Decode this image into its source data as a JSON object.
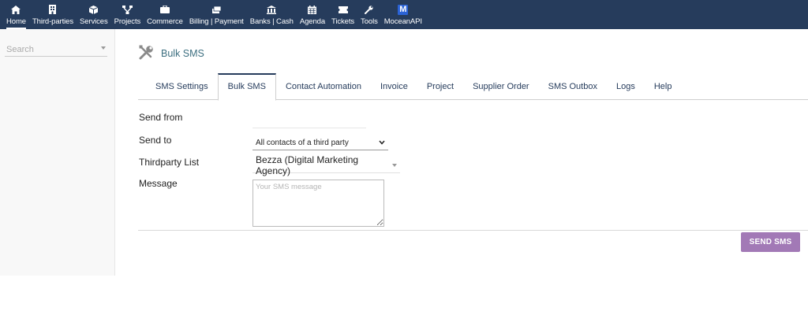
{
  "nav": {
    "items": [
      {
        "label": "Home",
        "icon": "home-icon",
        "active": true
      },
      {
        "label": "Third-parties",
        "icon": "building-icon",
        "active": false
      },
      {
        "label": "Services",
        "icon": "cube-icon",
        "active": false
      },
      {
        "label": "Projects",
        "icon": "sitemap-icon",
        "active": false
      },
      {
        "label": "Commerce",
        "icon": "suitcase-icon",
        "active": false
      },
      {
        "label": "Billing | Payment",
        "icon": "money-bill-icon",
        "active": false
      },
      {
        "label": "Banks | Cash",
        "icon": "bank-icon",
        "active": false
      },
      {
        "label": "Agenda",
        "icon": "calendar-icon",
        "active": false
      },
      {
        "label": "Tickets",
        "icon": "ticket-icon",
        "active": false
      },
      {
        "label": "Tools",
        "icon": "wrench-icon",
        "active": false
      },
      {
        "label": "MoceanAPI",
        "icon": "moceanapi-logo-icon",
        "active": false,
        "logo_letter": "M"
      }
    ]
  },
  "sidebar": {
    "search_placeholder": "Search"
  },
  "page": {
    "title": "Bulk SMS",
    "title_icon": "tools-icon"
  },
  "tabs": [
    {
      "label": "SMS Settings",
      "active": false
    },
    {
      "label": "Bulk SMS",
      "active": true
    },
    {
      "label": "Contact Automation",
      "active": false
    },
    {
      "label": "Invoice",
      "active": false
    },
    {
      "label": "Project",
      "active": false
    },
    {
      "label": "Supplier Order",
      "active": false
    },
    {
      "label": "SMS Outbox",
      "active": false
    },
    {
      "label": "Logs",
      "active": false
    },
    {
      "label": "Help",
      "active": false
    }
  ],
  "form": {
    "send_from_label": "Send from",
    "send_from_value": "",
    "send_to_label": "Send to",
    "send_to_value": "All contacts of a third party",
    "thirdparty_label": "Thirdparty List",
    "thirdparty_value": "Bezza (Digital Marketing Agency)",
    "message_label": "Message",
    "message_placeholder": "Your SMS message",
    "send_button": "SEND SMS"
  },
  "colors": {
    "topbar": "#263c5c",
    "button": "#a279b6",
    "title": "#3d6f80",
    "sidebar": "#f8f8f8"
  }
}
